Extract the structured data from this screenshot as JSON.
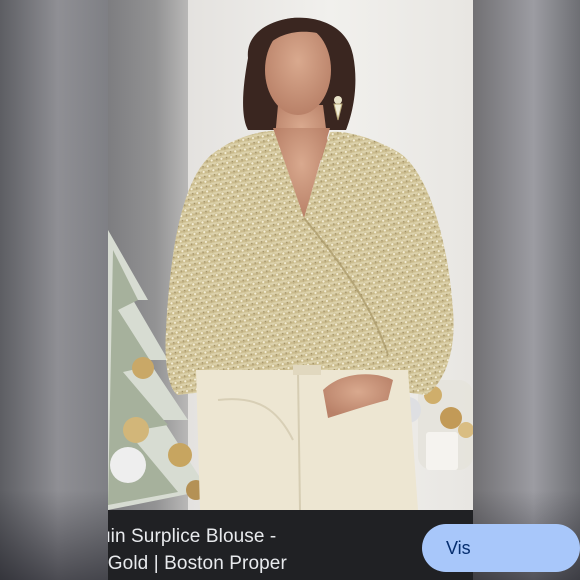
{
  "caption": {
    "line1": "uin Surplice Blouse -",
    "line2": "r/Gold | Boston Proper"
  },
  "visit_button": {
    "label": "Vis"
  },
  "colors": {
    "caption_bg": "#202124",
    "caption_text": "#e8eaed",
    "visit_bg": "#a8c7fa",
    "visit_text": "#062e6f"
  },
  "image": {
    "subject": "model in gold sequin surplice blouse and cream jeans beside a decorated christmas tree"
  }
}
